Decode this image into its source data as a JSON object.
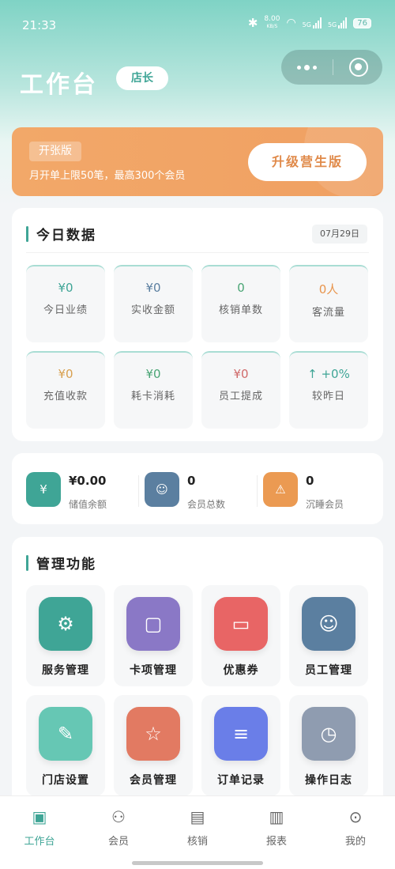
{
  "status_bar": {
    "time": "21:33",
    "net_speed_value": "8.00",
    "net_speed_unit": "KB/S",
    "sim1": "5G",
    "sim2": "5G",
    "battery": "76"
  },
  "header": {
    "title": "工作台",
    "role_badge": "店长"
  },
  "plan": {
    "tag": "开张版",
    "description": "月开单上限50笔，最高300个会员",
    "upgrade_label": "升级营生版"
  },
  "today": {
    "title": "今日数据",
    "date": "07月29日",
    "stats": [
      {
        "value": "¥0",
        "label": "今日业绩",
        "color": "#3fa596"
      },
      {
        "value": "¥0",
        "label": "实收金额",
        "color": "#5b7fa0"
      },
      {
        "value": "0",
        "label": "核销单数",
        "color": "#4aa575"
      },
      {
        "value": "0人",
        "label": "客流量",
        "color": "#e8954d"
      },
      {
        "value": "¥0",
        "label": "充值收款",
        "color": "#d8a050"
      },
      {
        "value": "¥0",
        "label": "耗卡消耗",
        "color": "#4aa575"
      },
      {
        "value": "¥0",
        "label": "员工提成",
        "color": "#d06a6a"
      },
      {
        "value": "↑ +0%",
        "label": "较昨日",
        "color": "#3fa596"
      }
    ]
  },
  "summary": {
    "items": [
      {
        "icon": "yen-icon",
        "value": "¥0.00",
        "label": "储值余额",
        "color": "#3fa596"
      },
      {
        "icon": "person-icon",
        "value": "0",
        "label": "会员总数",
        "color": "#5b7fa0"
      },
      {
        "icon": "warning-icon",
        "value": "0",
        "label": "沉睡会员",
        "color": "#eb9a52"
      }
    ]
  },
  "management": {
    "title": "管理功能",
    "items": [
      {
        "icon": "gear-icon",
        "label": "服务管理",
        "color": "#3fa596"
      },
      {
        "icon": "bag-icon",
        "label": "卡项管理",
        "color": "#8a78c6"
      },
      {
        "icon": "ticket-icon",
        "label": "优惠券",
        "color": "#e86565"
      },
      {
        "icon": "person-icon",
        "label": "员工管理",
        "color": "#5b7fa0"
      },
      {
        "icon": "pencil-icon",
        "label": "门店设置",
        "color": "#66c7b4"
      },
      {
        "icon": "star-icon",
        "label": "会员管理",
        "color": "#e27a62"
      },
      {
        "icon": "list-icon",
        "label": "订单记录",
        "color": "#6a7ee8"
      },
      {
        "icon": "clock-icon",
        "label": "操作日志",
        "color": "#8f9cb0"
      }
    ]
  },
  "tabbar": {
    "tabs": [
      {
        "icon": "dashboard-icon",
        "label": "工作台",
        "active": true
      },
      {
        "icon": "members-icon",
        "label": "会员",
        "active": false
      },
      {
        "icon": "new-icon",
        "label": "核销",
        "active": false
      },
      {
        "icon": "chart-icon",
        "label": "报表",
        "active": false
      },
      {
        "icon": "profile-icon",
        "label": "我的",
        "active": false
      }
    ]
  }
}
